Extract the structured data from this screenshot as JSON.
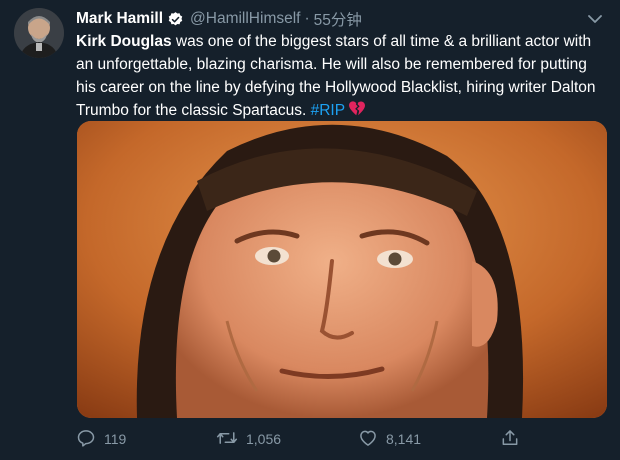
{
  "tweet": {
    "display_name": "Mark Hamill",
    "handle": "@HamillHimself",
    "separator": "·",
    "time": "55分钟",
    "text_bold": "Kirk Douglas",
    "text_main": " was one of the biggest stars of all time & a brilliant actor with an unforgettable, blazing charisma. He will also be remembered for putting his career on the line by defying the Hollywood Blacklist, hiring writer Dalton Trumbo for the classic Spartacus. ",
    "hashtag": "#RIP",
    "emoji": "broken-heart-icon"
  },
  "actions": {
    "reply_count": "119",
    "retweet_count": "1,056",
    "like_count": "8,141"
  },
  "icons": {
    "verified": "verified-badge-icon",
    "menu": "chevron-down-icon",
    "reply": "reply-icon",
    "retweet": "retweet-icon",
    "like": "heart-icon",
    "share": "share-icon"
  },
  "colors": {
    "background": "#15202b",
    "accent": "#1da1f2",
    "muted": "#8899a6",
    "broken_heart": "#e0245e"
  }
}
